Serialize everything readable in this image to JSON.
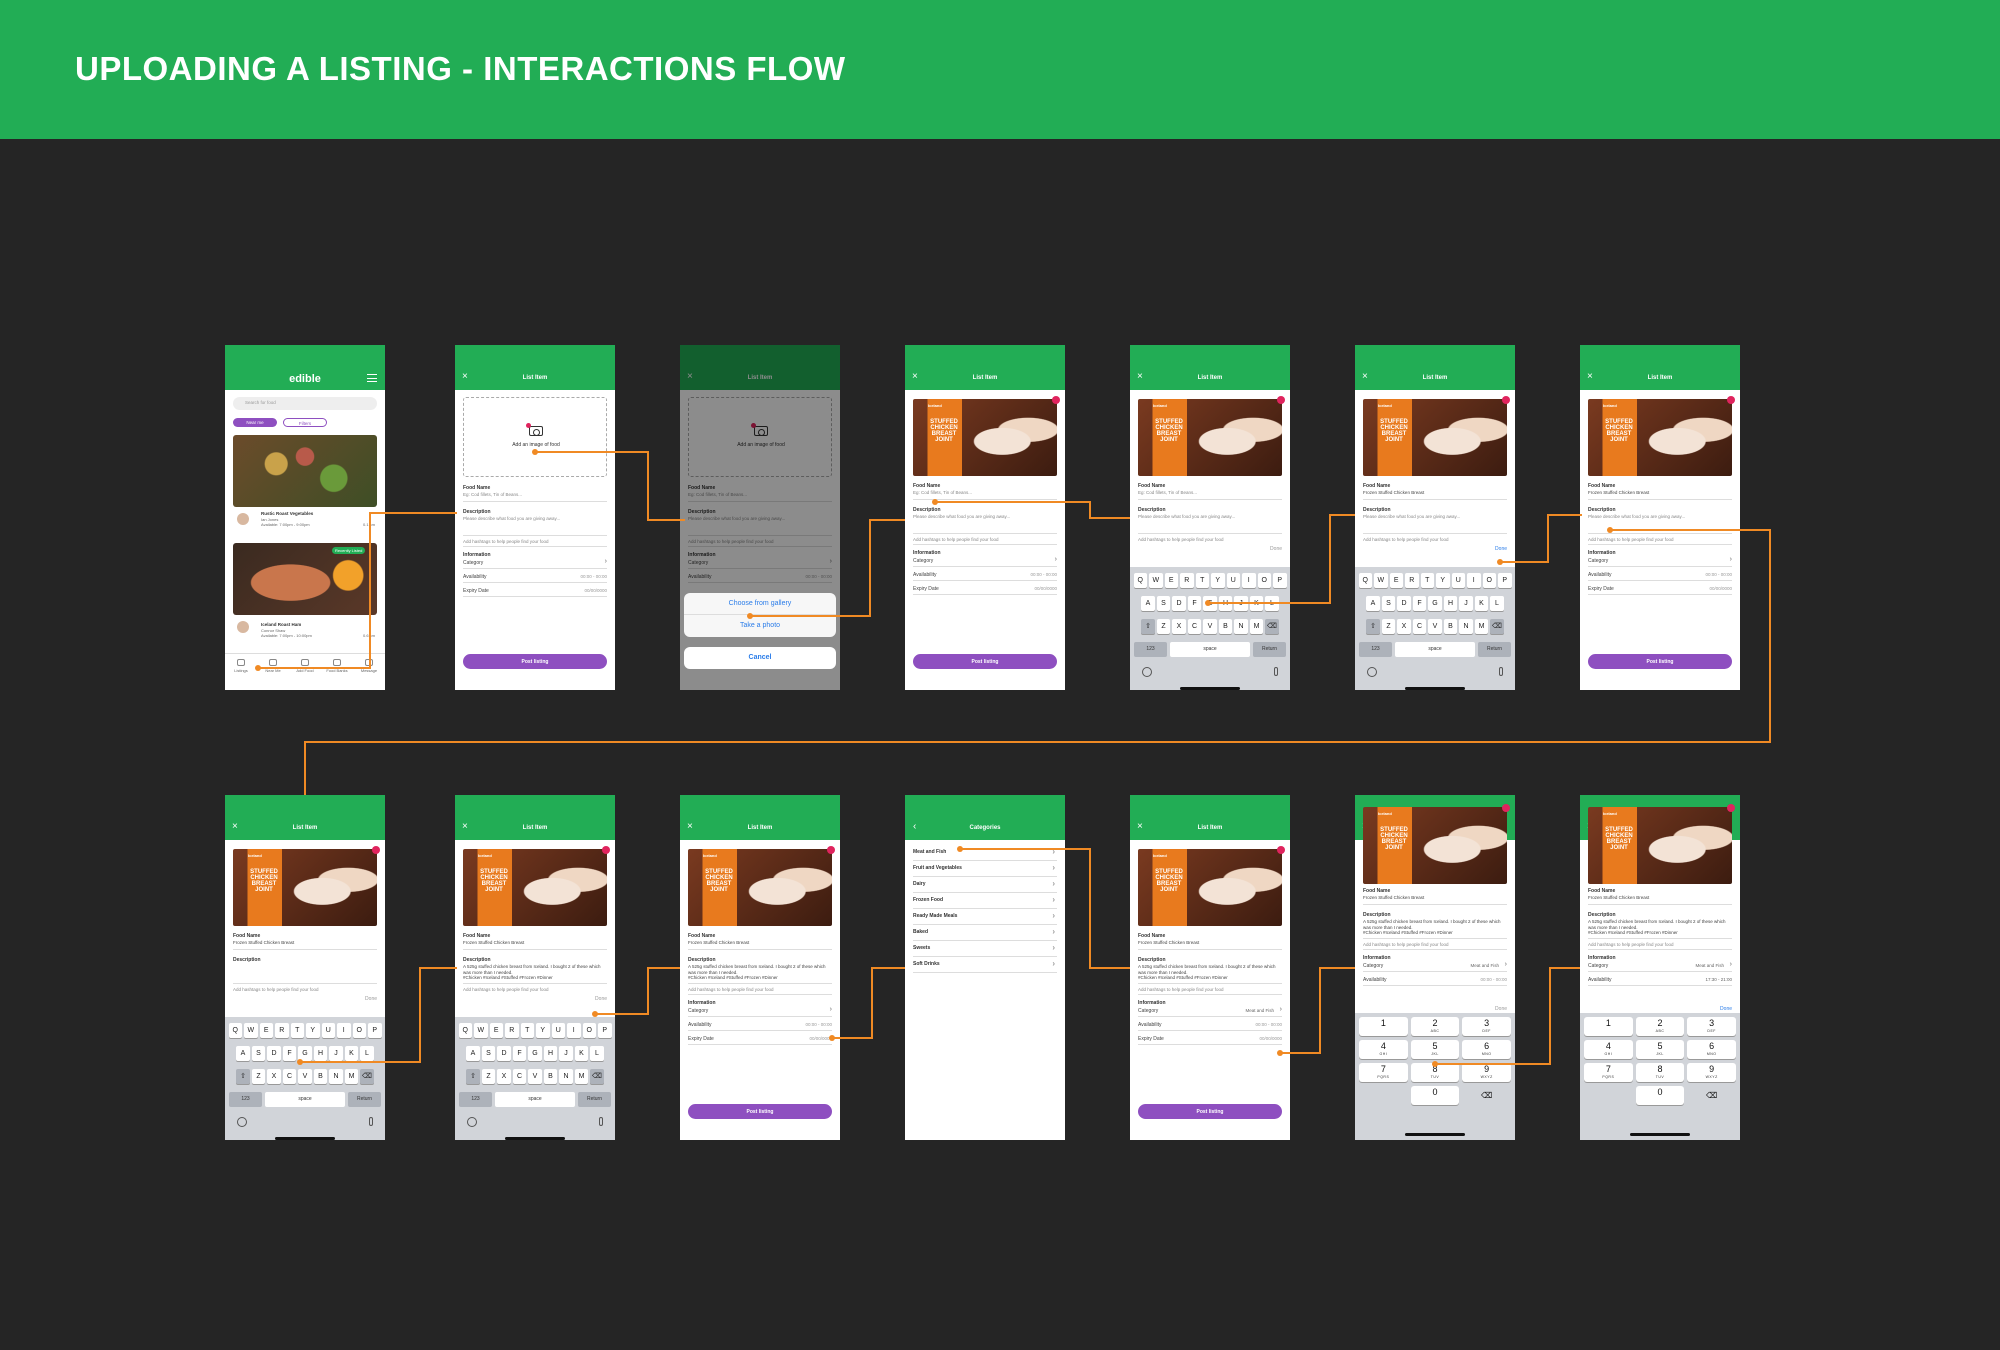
{
  "title": "UPLOADING A LISTING - INTERACTIONS FLOW",
  "colors": {
    "brand_green": "#22ad55",
    "purple": "#8e4fc0",
    "flow_line": "#f08a24",
    "background": "#252525"
  },
  "app": {
    "logo": "edible",
    "header_title": "List Item",
    "categories_title": "Categories"
  },
  "home": {
    "search_placeholder": "Search for food",
    "chip_near": "Near me",
    "chip_filters": "Filters",
    "recently_listed": "Recently Listed",
    "items": [
      {
        "name": "Rustic Roast Vegetables",
        "sub": "Ian Jones",
        "avail": "Available: 7:00pm - 9:00pm",
        "dist": "0.1 km"
      },
      {
        "name": "Iceland Roast Ham",
        "sub": "Connor Shaw",
        "avail": "Available: 7:00pm - 10:00pm",
        "dist": "0.6 km"
      }
    ],
    "tabs": [
      "Listings",
      "Near Me",
      "Add Food",
      "Food Banks",
      "Message"
    ]
  },
  "form": {
    "add_image": "Add an image of food",
    "food_name_label": "Food Name",
    "food_name_placeholder": "Eg: Cod fillets, Tin of Beans...",
    "food_name_value": "Frozen Stuffed Chicken Breast",
    "description_label": "Description",
    "description_placeholder": "Please describe what food you are giving away...",
    "description_value": "A 525g stuffed chicken breast from Iceland. I bought 2 of these which was more than I needed.",
    "hashtags_value": "#Chicken #Iceland #Stuffed #Frozen #Dinner",
    "hashtag_hint": "Add hashtags to help people find your food",
    "information_label": "Information",
    "category_label": "Category",
    "category_value": "Meat and Fish",
    "availability_label": "Availability",
    "availability_placeholder": "00:00 - 00:00",
    "availability_value": "17:30 - 21:00",
    "expiry_label": "Expiry Date",
    "expiry_placeholder": "00/00/0000",
    "post_button": "Post listing",
    "done": "Done"
  },
  "photo_sheet": {
    "gallery": "Choose from gallery",
    "photo": "Take a photo",
    "cancel": "Cancel"
  },
  "image": {
    "brand": "Iceland",
    "lines": [
      "STUFFED",
      "CHICKEN",
      "BREAST",
      "JOINT"
    ]
  },
  "categories": [
    "Meat and Fish",
    "Fruit and Vegetables",
    "Dairy",
    "Frozen Food",
    "Ready Made Meals",
    "Baked",
    "Sweets",
    "Soft Drinks"
  ],
  "keyboard": {
    "row1": [
      "Q",
      "W",
      "E",
      "R",
      "T",
      "Y",
      "U",
      "I",
      "O",
      "P"
    ],
    "row2": [
      "A",
      "S",
      "D",
      "F",
      "G",
      "H",
      "J",
      "K",
      "L"
    ],
    "row3": [
      "Z",
      "X",
      "C",
      "V",
      "B",
      "N",
      "M"
    ],
    "k123": "123",
    "space": "space",
    "return": "Return"
  },
  "numpad": [
    [
      {
        "d": "1",
        "l": ""
      },
      {
        "d": "2",
        "l": "ABC"
      },
      {
        "d": "3",
        "l": "DEF"
      }
    ],
    [
      {
        "d": "4",
        "l": "GHI"
      },
      {
        "d": "5",
        "l": "JKL"
      },
      {
        "d": "6",
        "l": "MNO"
      }
    ],
    [
      {
        "d": "7",
        "l": "PQRS"
      },
      {
        "d": "8",
        "l": "TUV"
      },
      {
        "d": "9",
        "l": "WXYZ"
      }
    ],
    [
      {
        "d": "",
        "l": ""
      },
      {
        "d": "0",
        "l": ""
      },
      {
        "d": "⌫",
        "l": ""
      }
    ]
  ]
}
